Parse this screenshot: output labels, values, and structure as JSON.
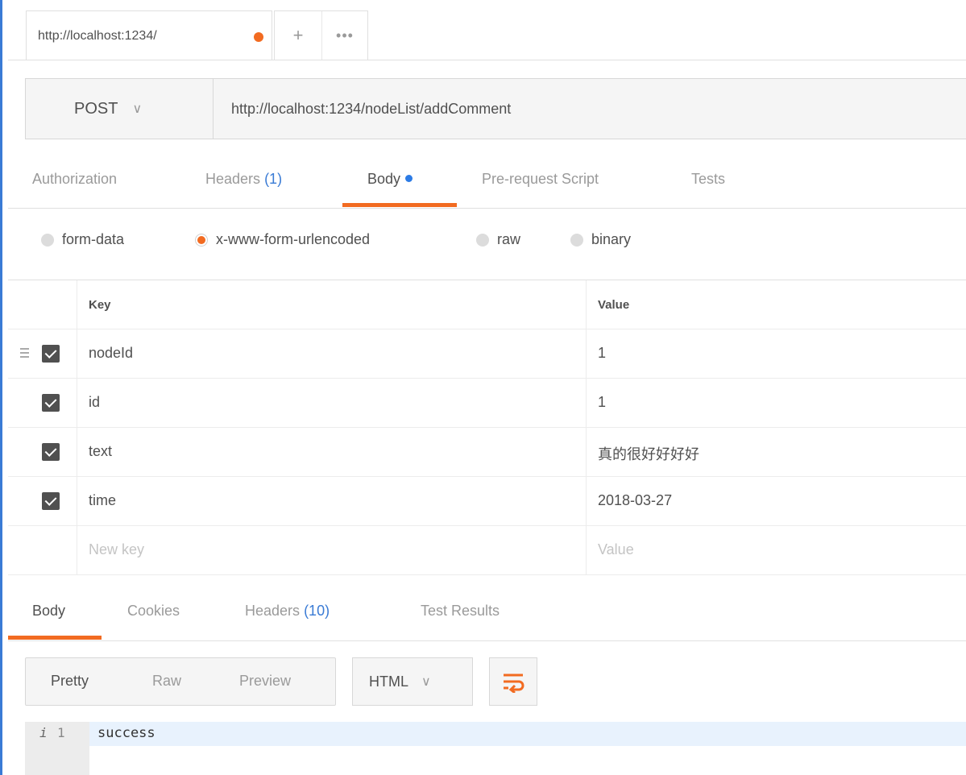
{
  "tab": {
    "title": "http://localhost:1234/",
    "plus": "+",
    "more": "•••"
  },
  "request": {
    "method": "POST",
    "url": "http://localhost:1234/nodeList/addComment"
  },
  "request_tabs": {
    "authorization": "Authorization",
    "headers": "Headers",
    "headers_count": "(1)",
    "body": "Body",
    "prerequest": "Pre-request Script",
    "tests": "Tests"
  },
  "body_types": [
    "form-data",
    "x-www-form-urlencoded",
    "raw",
    "binary"
  ],
  "params": {
    "key_header": "Key",
    "value_header": "Value",
    "rows": [
      {
        "key": "nodeId",
        "value": "1"
      },
      {
        "key": "id",
        "value": "1"
      },
      {
        "key": "text",
        "value": "真的很好好好好"
      },
      {
        "key": "time",
        "value": "2018-03-27"
      }
    ],
    "new_key_placeholder": "New key",
    "new_value_placeholder": "Value"
  },
  "response_tabs": {
    "body": "Body",
    "cookies": "Cookies",
    "headers": "Headers",
    "headers_count": "(10)",
    "test_results": "Test Results"
  },
  "response_view": {
    "pretty": "Pretty",
    "raw": "Raw",
    "preview": "Preview",
    "format": "HTML"
  },
  "response_body": {
    "info_glyph": "i",
    "line_number": "1",
    "content": "success"
  },
  "colors": {
    "accent": "#f26b21",
    "link": "#3a7bd5",
    "body_dot": "#2c7be5"
  },
  "icons": [
    "unsaved-dot-icon",
    "plus-icon",
    "more-icon",
    "chevron-down-icon",
    "drag-handle-icon",
    "checkbox-checked-icon",
    "wrap-lines-icon",
    "info-icon"
  ]
}
